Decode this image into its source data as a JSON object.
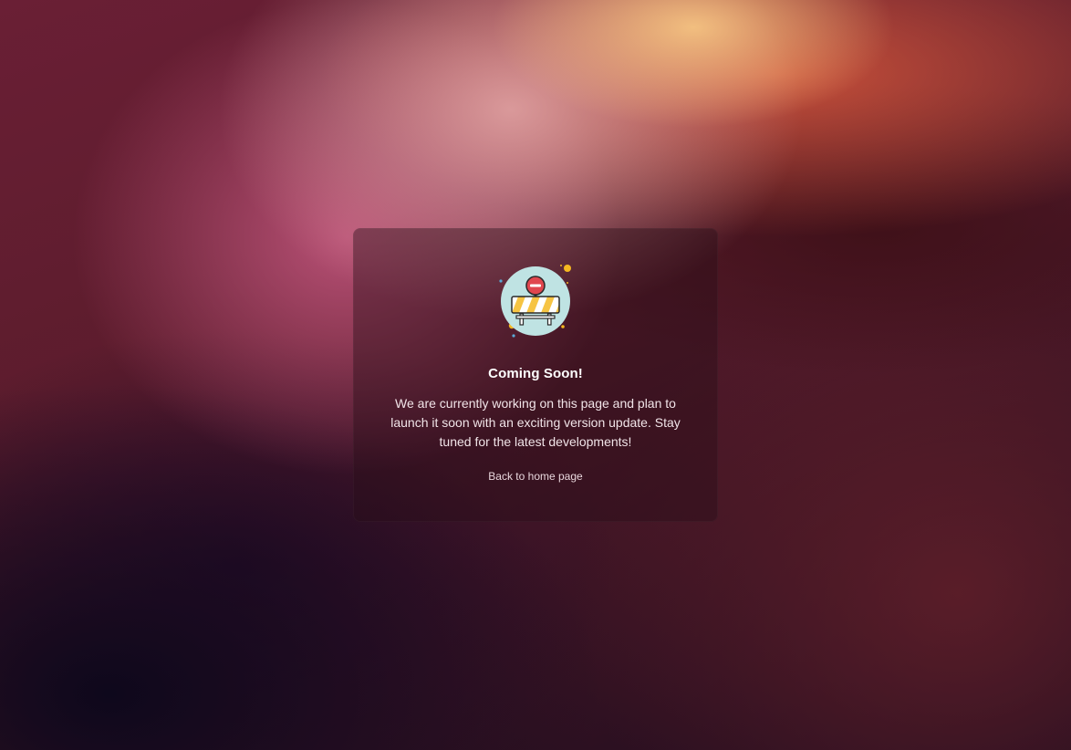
{
  "card": {
    "illustration_icon": "road-barrier-icon",
    "title": "Coming Soon!",
    "message": "We are currently working on this page and plan to launch it soon with an exciting version update. Stay tuned for the latest developments!",
    "home_link_label": "Back to home page"
  },
  "colors": {
    "illustration_circle": "#bfe3e3",
    "stop_sign": "#e0464e",
    "barrier_stripe_yellow": "#f6c443",
    "barrier_stripe_white": "#ffffff",
    "sparkle_yellow": "#f5b820",
    "sparkle_blue": "#5aa9d6"
  }
}
